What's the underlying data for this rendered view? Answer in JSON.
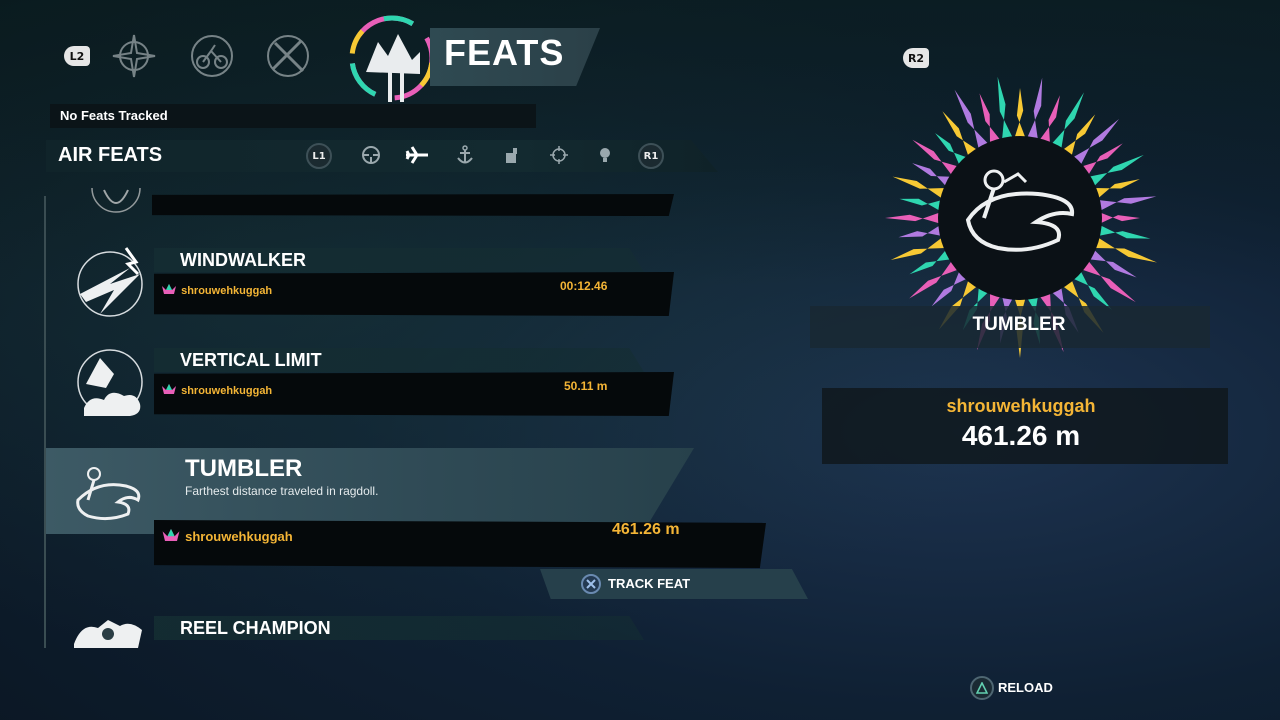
{
  "header": {
    "left_trigger": "L2",
    "right_trigger": "R2",
    "title": "FEATS",
    "category_icons": [
      "compass-icon",
      "bike-icon",
      "crossed-guns-icon"
    ]
  },
  "tracking": {
    "status": "No Feats Tracked"
  },
  "category_bar": {
    "label": "AIR FEATS",
    "left_bumper": "L1",
    "right_bumper": "R1",
    "sub_icons": [
      "steering-wheel-icon",
      "airplane-icon",
      "anchor-icon",
      "fist-icon",
      "crosshair-icon",
      "lightbulb-icon"
    ],
    "active_sub_icon": "airplane-icon"
  },
  "feats": [
    {
      "title": "WINDWALKER",
      "player": "shrouwehkuggah",
      "score": "00:12.46"
    },
    {
      "title": "VERTICAL LIMIT",
      "player": "shrouwehkuggah",
      "score": "50.11 m"
    },
    {
      "title": "TUMBLER",
      "description": "Farthest distance traveled in ragdoll.",
      "player": "shrouwehkuggah",
      "score": "461.26 m",
      "selected": true
    },
    {
      "title": "REEL CHAMPION"
    }
  ],
  "actions": {
    "track_feat": "TRACK FEAT",
    "reload": "RELOAD"
  },
  "detail": {
    "name": "TUMBLER",
    "player": "shrouwehkuggah",
    "score": "461.26 m"
  },
  "colors": {
    "accent_gold": "#f4b536",
    "badge_pink": "#e85fb8",
    "badge_teal": "#2fd6b0",
    "badge_yellow": "#f7c934",
    "badge_purple": "#b07ae0"
  }
}
